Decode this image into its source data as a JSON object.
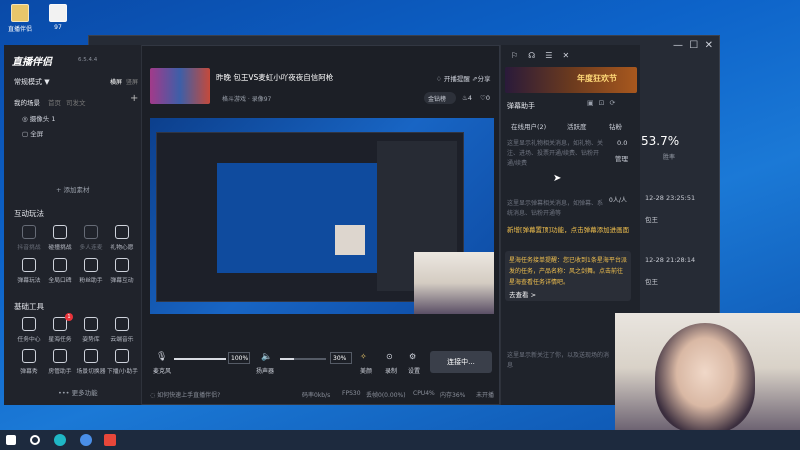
{
  "desktop": {
    "icons": [
      "直播伴侣",
      "97"
    ]
  },
  "app": {
    "name": "直播伴侣",
    "version": "6.5.4.4"
  },
  "left": {
    "mode": "常规模式 ▼",
    "mode_links": [
      "横屏",
      "竖屏"
    ],
    "scene_tabs": [
      "我的场景",
      "首页",
      "司发文"
    ],
    "sources": [
      "摄像头 1",
      "全屏"
    ],
    "add_material": "+ 添加素材",
    "interactive_title": "互动玩法",
    "interactive": [
      "抖音挑战",
      "碰撞挑战",
      "多人连麦",
      "礼物心愿",
      "弹幕玩法",
      "全局口碑",
      "粉丝助手",
      "弹幕互动"
    ],
    "tools_title": "基础工具",
    "tools": [
      "任务中心",
      "星海任务",
      "姿势库",
      "云端音乐",
      "弹幕秀",
      "房管助手",
      "场景切换器",
      "下播/小助手"
    ],
    "tool_badge": "1",
    "more": "更多功能"
  },
  "stream": {
    "title": "昨晚 包王VS麦虹小吖夜夜自信阿枪",
    "sub": "格斗游戏 · 录像97",
    "start_live": "开播提醒",
    "share": "分享",
    "gold": "金钻榜",
    "likes": "4",
    "hearts": "0"
  },
  "controls": {
    "mic": "麦克风",
    "mic_vol": "100%",
    "speaker": "扬声器",
    "spk_vol": "30%",
    "beauty": "美颜",
    "record": "录制",
    "settings": "设置",
    "connect": "连接中..."
  },
  "status": {
    "tip": "如何快速上手直播伴侣?",
    "speed": "码率0kb/s",
    "fps": "FPS30",
    "drop": "丢帧0(0.00%)",
    "cpu": "CPU4%",
    "mem": "内存36%",
    "unopened": "未开播"
  },
  "right": {
    "title": "弹幕助手",
    "tabs": [
      "在线用户(2)",
      "活跃度",
      "钻粉"
    ],
    "gift_empty": "这里显示礼物相关消息，如礼物、关注、进场、投票开通/续费、钻粉开通/续费",
    "manage": "管理",
    "count": "0.0",
    "people": "0人/人",
    "msg_empty": "这里显示弹幕相关消息，如弹幕、系统消息、钻粉开通等",
    "notice1": "新增[弹幕置顶]功能，点击弹幕添加进画面",
    "notice2": "星海任务接单提醒：您已收到1条星海平台派发的任务，产品名称：风之剑舞。点击前往星海查看任务详情吧。",
    "view": "去查看 >",
    "bottom_note": "这里显示新关注了你，以及送现场的消息"
  },
  "bg": {
    "banner": "年度狂欢节",
    "rate": "53.7%",
    "rate_label": "胜率",
    "time1": "12-28 23:25:51",
    "name1": "包王",
    "time2": "12-28 21:28:14",
    "name2": "包王"
  }
}
